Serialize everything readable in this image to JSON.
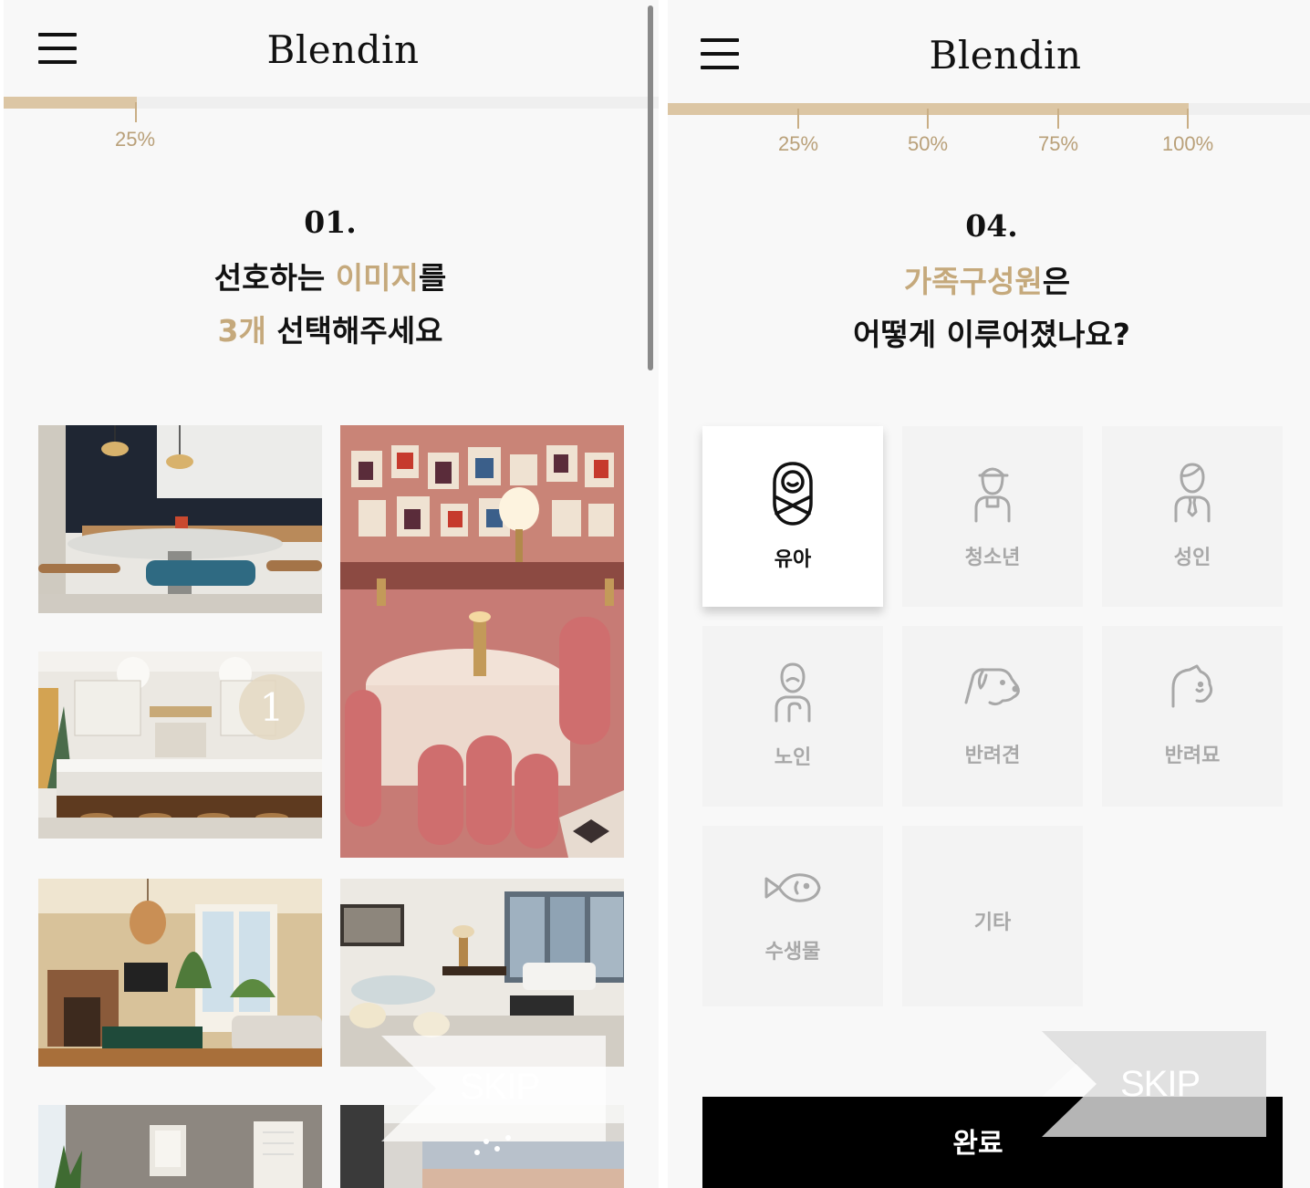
{
  "left_screen": {
    "app_title": "Blendin",
    "progress": {
      "value_percent": 25,
      "labels": [
        "25%"
      ]
    },
    "question": {
      "number": "01.",
      "line1_before": "선호하는 ",
      "line1_accent": "이미지",
      "line1_after": "를",
      "line2_accent": "3개",
      "line2_after": " 선택해주세요"
    },
    "images": [
      {
        "id": "cafe",
        "selected": false
      },
      {
        "id": "pink-restaurant",
        "selected": false
      },
      {
        "id": "kitchen",
        "selected": true,
        "badge": "1"
      },
      {
        "id": "warm-living-room",
        "selected": false
      },
      {
        "id": "bright-apartment",
        "selected": false
      },
      {
        "id": "hallway",
        "selected": false
      },
      {
        "id": "dining-view",
        "selected": false
      }
    ],
    "skip_label": "SKIP"
  },
  "right_screen": {
    "app_title": "Blendin",
    "progress": {
      "value_percent": 100,
      "labels": [
        "25%",
        "50%",
        "75%",
        "100%"
      ]
    },
    "question": {
      "number": "04.",
      "line1_accent": "가족구성원",
      "line1_after": "은",
      "line2": "어떻게 이루어졌나요?"
    },
    "options": [
      {
        "label": "유아",
        "icon": "baby-icon",
        "selected": true
      },
      {
        "label": "청소년",
        "icon": "teen-icon",
        "selected": false
      },
      {
        "label": "성인",
        "icon": "adult-icon",
        "selected": false
      },
      {
        "label": "노인",
        "icon": "elder-icon",
        "selected": false
      },
      {
        "label": "반려견",
        "icon": "dog-icon",
        "selected": false
      },
      {
        "label": "반려묘",
        "icon": "cat-icon",
        "selected": false
      },
      {
        "label": "수생물",
        "icon": "fish-icon",
        "selected": false
      },
      {
        "label": "기타",
        "icon": "",
        "selected": false
      }
    ],
    "skip_label": "SKIP",
    "done_label": "완료"
  },
  "colors": {
    "accent": "#c5a97c",
    "progress_fill": "#dcc6a4",
    "progress_label": "#b9a079",
    "button_bg": "#000000",
    "card_bg": "#f3f3f3",
    "selected_card_bg": "#ffffff"
  }
}
